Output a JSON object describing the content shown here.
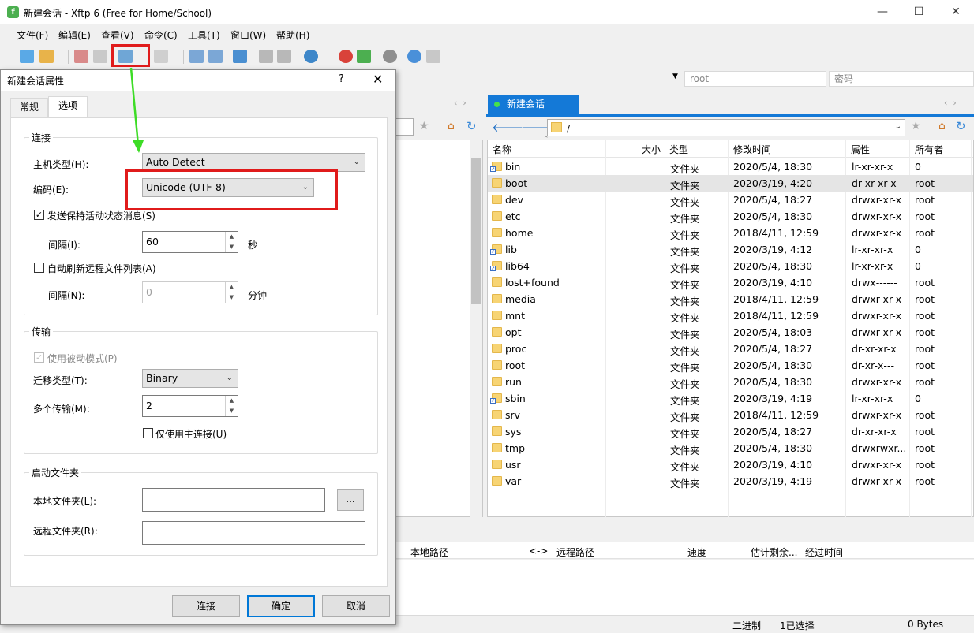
{
  "window": {
    "title": "新建会话 - Xftp 6 (Free for Home/School)",
    "app_icon": "xftp-logo-icon"
  },
  "menu": [
    "文件(F)",
    "编辑(E)",
    "查看(V)",
    "命令(C)",
    "工具(T)",
    "窗口(W)",
    "帮助(H)"
  ],
  "address": {
    "user": "root",
    "password": "密码"
  },
  "remote_tab": {
    "label": "新建会话"
  },
  "remote_path": "/",
  "file_list": {
    "columns": [
      "名称",
      "大小",
      "类型",
      "修改时间",
      "属性",
      "所有者"
    ],
    "rows": [
      {
        "name": "bin",
        "size": "",
        "type": "文件夹",
        "mtime": "2020/5/4, 18:30",
        "attr": "lr-xr-xr-x",
        "owner": "0",
        "link": true
      },
      {
        "name": "boot",
        "size": "",
        "type": "文件夹",
        "mtime": "2020/3/19, 4:20",
        "attr": "dr-xr-xr-x",
        "owner": "root",
        "link": false
      },
      {
        "name": "dev",
        "size": "",
        "type": "文件夹",
        "mtime": "2020/5/4, 18:27",
        "attr": "drwxr-xr-x",
        "owner": "root",
        "link": false
      },
      {
        "name": "etc",
        "size": "",
        "type": "文件夹",
        "mtime": "2020/5/4, 18:30",
        "attr": "drwxr-xr-x",
        "owner": "root",
        "link": false
      },
      {
        "name": "home",
        "size": "",
        "type": "文件夹",
        "mtime": "2018/4/11, 12:59",
        "attr": "drwxr-xr-x",
        "owner": "root",
        "link": false
      },
      {
        "name": "lib",
        "size": "",
        "type": "文件夹",
        "mtime": "2020/3/19, 4:12",
        "attr": "lr-xr-xr-x",
        "owner": "0",
        "link": true
      },
      {
        "name": "lib64",
        "size": "",
        "type": "文件夹",
        "mtime": "2020/5/4, 18:30",
        "attr": "lr-xr-xr-x",
        "owner": "0",
        "link": true
      },
      {
        "name": "lost+found",
        "size": "",
        "type": "文件夹",
        "mtime": "2020/3/19, 4:10",
        "attr": "drwx------",
        "owner": "root",
        "link": false
      },
      {
        "name": "media",
        "size": "",
        "type": "文件夹",
        "mtime": "2018/4/11, 12:59",
        "attr": "drwxr-xr-x",
        "owner": "root",
        "link": false
      },
      {
        "name": "mnt",
        "size": "",
        "type": "文件夹",
        "mtime": "2018/4/11, 12:59",
        "attr": "drwxr-xr-x",
        "owner": "root",
        "link": false
      },
      {
        "name": "opt",
        "size": "",
        "type": "文件夹",
        "mtime": "2020/5/4, 18:03",
        "attr": "drwxr-xr-x",
        "owner": "root",
        "link": false
      },
      {
        "name": "proc",
        "size": "",
        "type": "文件夹",
        "mtime": "2020/5/4, 18:27",
        "attr": "dr-xr-xr-x",
        "owner": "root",
        "link": false
      },
      {
        "name": "root",
        "size": "",
        "type": "文件夹",
        "mtime": "2020/5/4, 18:30",
        "attr": "dr-xr-x---",
        "owner": "root",
        "link": false
      },
      {
        "name": "run",
        "size": "",
        "type": "文件夹",
        "mtime": "2020/5/4, 18:30",
        "attr": "drwxr-xr-x",
        "owner": "root",
        "link": false
      },
      {
        "name": "sbin",
        "size": "",
        "type": "文件夹",
        "mtime": "2020/3/19, 4:19",
        "attr": "lr-xr-xr-x",
        "owner": "0",
        "link": true
      },
      {
        "name": "srv",
        "size": "",
        "type": "文件夹",
        "mtime": "2018/4/11, 12:59",
        "attr": "drwxr-xr-x",
        "owner": "root",
        "link": false
      },
      {
        "name": "sys",
        "size": "",
        "type": "文件夹",
        "mtime": "2020/5/4, 18:27",
        "attr": "dr-xr-xr-x",
        "owner": "root",
        "link": false
      },
      {
        "name": "tmp",
        "size": "",
        "type": "文件夹",
        "mtime": "2020/5/4, 18:30",
        "attr": "drwxrwxr...",
        "owner": "root",
        "link": false
      },
      {
        "name": "usr",
        "size": "",
        "type": "文件夹",
        "mtime": "2020/3/19, 4:10",
        "attr": "drwxr-xr-x",
        "owner": "root",
        "link": false
      },
      {
        "name": "var",
        "size": "",
        "type": "文件夹",
        "mtime": "2020/3/19, 4:19",
        "attr": "drwxr-xr-x",
        "owner": "root",
        "link": false
      }
    ],
    "selected_index": 1
  },
  "transfer": {
    "columns": [
      "本地路径",
      "<->",
      "远程路径",
      "速度",
      "估计剩余...",
      "经过时间"
    ]
  },
  "status": {
    "mode": "二进制",
    "selection": "1已选择",
    "bytes": "0 Bytes"
  },
  "dialog": {
    "title": "新建会话属性",
    "help": "?",
    "tabs": [
      "常规",
      "选项"
    ],
    "active_tab": 1,
    "connection": {
      "group": "连接",
      "host_type_label": "主机类型(H):",
      "host_type_value": "Auto Detect",
      "encoding_label": "编码(E):",
      "encoding_value": "Unicode (UTF-8)",
      "keepalive_label": "发送保持活动状态消息(S)",
      "keepalive_checked": true,
      "interval_label": "间隔(I):",
      "interval_value": "60",
      "interval_unit": "秒",
      "autorefresh_label": "自动刷新远程文件列表(A)",
      "autorefresh_checked": false,
      "refresh_interval_label": "间隔(N):",
      "refresh_interval_value": "0",
      "refresh_interval_unit": "分钟"
    },
    "transfer": {
      "group": "传输",
      "passive_label": "使用被动模式(P)",
      "passive_checked": true,
      "transfer_type_label": "迁移类型(T):",
      "transfer_type_value": "Binary",
      "multi_label": "多个传输(M):",
      "multi_value": "2",
      "main_only_label": "仅使用主连接(U)",
      "main_only_checked": false
    },
    "startup": {
      "group": "启动文件夹",
      "local_label": "本地文件夹(L):",
      "local_value": "",
      "browse_label": "...",
      "remote_label": "远程文件夹(R):",
      "remote_value": ""
    },
    "buttons": {
      "connect": "连接",
      "ok": "确定",
      "cancel": "取消"
    }
  },
  "colors": {
    "accent": "#1479d7",
    "highlight": "#e01b1b",
    "arrow": "#3ddc26"
  }
}
